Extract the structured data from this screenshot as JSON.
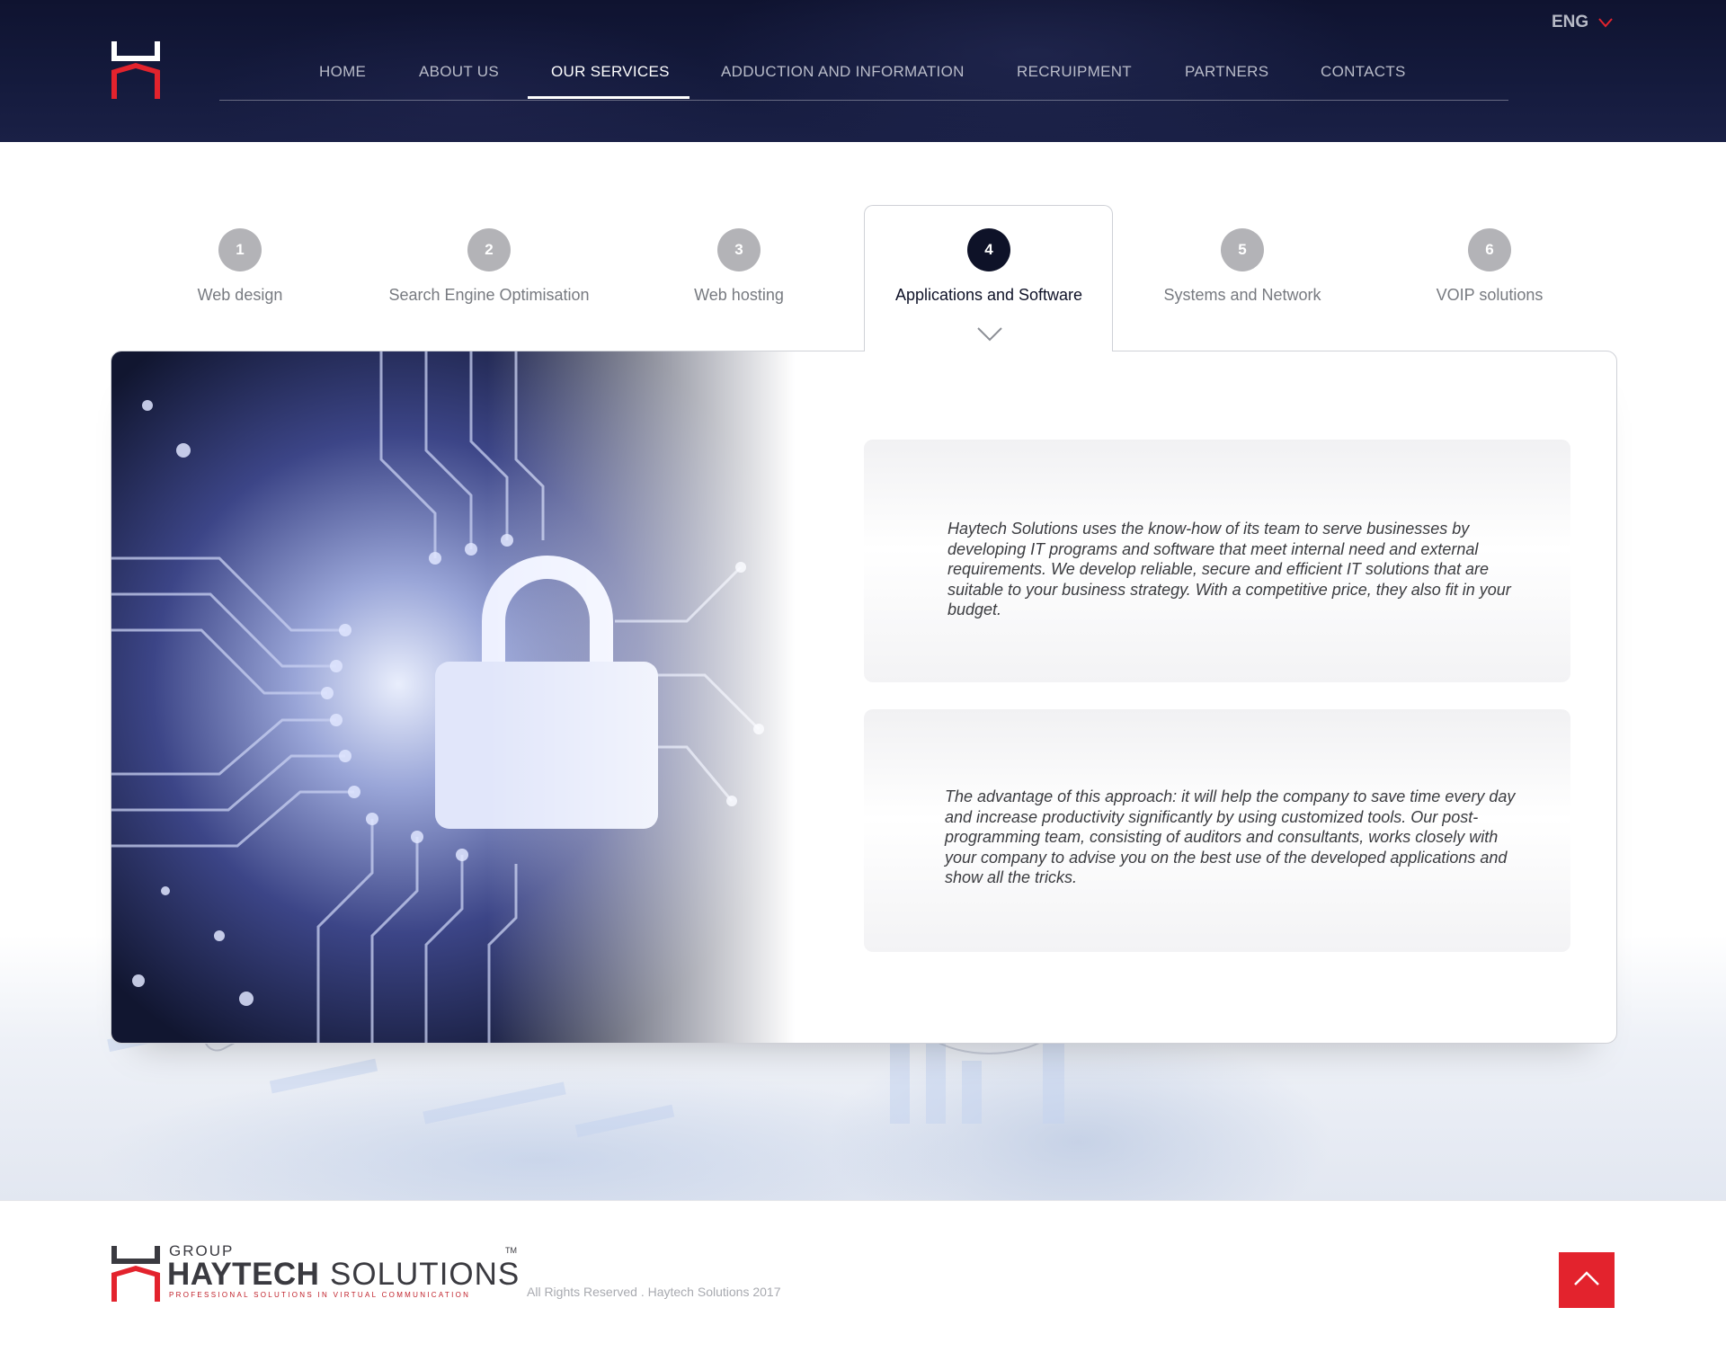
{
  "header": {
    "nav": [
      {
        "label": "HOME"
      },
      {
        "label": "ABOUT US"
      },
      {
        "label": "OUR SERVICES",
        "active": true
      },
      {
        "label": "ADDUCTION AND INFORMATION"
      },
      {
        "label": "RECRUIPMENT"
      },
      {
        "label": "PARTNERS"
      },
      {
        "label": "CONTACTS"
      }
    ],
    "language": "ENG"
  },
  "services": {
    "tabs": [
      {
        "num": "1",
        "label": "Web design"
      },
      {
        "num": "2",
        "label": "Search Engine Optimisation"
      },
      {
        "num": "3",
        "label": "Web hosting"
      },
      {
        "num": "4",
        "label": "Applications and Software",
        "active": true
      },
      {
        "num": "5",
        "label": "Systems and Network"
      },
      {
        "num": "6",
        "label": "VOIP solutions"
      }
    ],
    "paragraphs": [
      "Haytech Solutions uses the know-how of its team to serve businesses by developing IT programs and software that meet internal need and external requirements. We develop reliable, secure and efficient IT solutions that are suitable to your business strategy. With a competitive price, they also fit in your budget.",
      "The advantage of this approach: it will help the company to save time every day and increase productivity significantly by using customized tools. Our post-programming team, consisting of auditors and consultants, works closely with your company to advise you on the best use of the developed applications and show all the tricks."
    ]
  },
  "footer": {
    "logo_group": "GROUP",
    "logo_haytech": "HAYTECH",
    "logo_solutions": "SOLUTIONS",
    "logo_tm": "TM",
    "logo_tagline": "PROFESSIONAL SOLUTIONS IN VIRTUAL COMMUNICATION",
    "copyright": "All Rights Reserved . Haytech Solutions 2017"
  },
  "colors": {
    "header_bg": "#141a3c",
    "accent_red": "#e3232d",
    "active_tab": "#0e1228",
    "inactive_circle": "#b3b3b7"
  },
  "icons": [
    "haytech-logo-icon",
    "chevron-down-icon",
    "tab-pointer-icon",
    "padlock-icon",
    "arrow-up-icon"
  ]
}
